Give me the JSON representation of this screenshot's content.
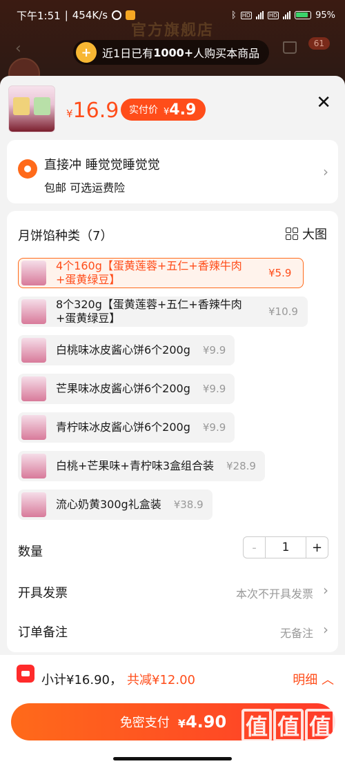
{
  "status": {
    "time": "下午1:51",
    "speed": "454K/s",
    "battery": "95%"
  },
  "background": {
    "store_title": "官方旗舰店",
    "cart_count": "61"
  },
  "toast": {
    "text_pre": "近1日已有",
    "count": "1000+",
    "text_post": "人购买本商品"
  },
  "product": {
    "currency": "¥",
    "price": "16.9",
    "paid_label": "实付价",
    "paid_price": "4.9"
  },
  "address": {
    "name": "直接冲 睡觉觉睡觉觉",
    "shipping": "包邮 可选运费险"
  },
  "sku": {
    "title": "月饼馅种类（7）",
    "big_view": "大图",
    "options": [
      {
        "label": "4个160g【蛋黄莲蓉+五仁+香辣牛肉+蛋黄绿豆】",
        "price": "¥5.9",
        "selected": true
      },
      {
        "label": "8个320g【蛋黄莲蓉+五仁+香辣牛肉+蛋黄绿豆】",
        "price": "¥10.9",
        "selected": false
      },
      {
        "label": "白桃味冰皮酱心饼6个200g",
        "price": "¥9.9",
        "selected": false
      },
      {
        "label": "芒果味冰皮酱心饼6个200g",
        "price": "¥9.9",
        "selected": false
      },
      {
        "label": "青柠味冰皮酱心饼6个200g",
        "price": "¥9.9",
        "selected": false
      },
      {
        "label": "白桃+芒果味+青柠味3盒组合装",
        "price": "¥28.9",
        "selected": false
      },
      {
        "label": "流心奶黄300g礼盒装",
        "price": "¥38.9",
        "selected": false
      }
    ]
  },
  "quantity": {
    "label": "数量",
    "minus": "-",
    "value": "1",
    "plus": "+"
  },
  "invoice": {
    "label": "开具发票",
    "value": "本次不开具发票"
  },
  "remark": {
    "label": "订单备注",
    "value": "无备注"
  },
  "footer": {
    "subtotal": "小计¥16.90，",
    "saved": "共减¥12.00",
    "detail": "明细",
    "pay_label": "免密支付",
    "pay_currency": "¥",
    "pay_amount": "4.90"
  },
  "watermark": {
    "chars": [
      "值",
      "值",
      "值"
    ],
    "url": "zhizhizhi.com"
  },
  "colors": {
    "accent": "#ff4d1a",
    "selected_bg": "#fff3ec",
    "sheet_bg": "#f3f3f3"
  }
}
